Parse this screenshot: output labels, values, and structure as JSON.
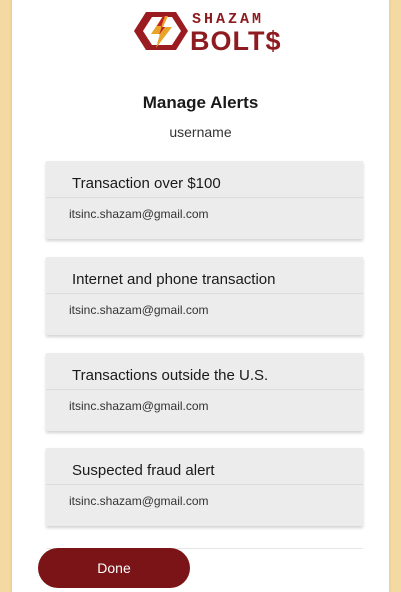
{
  "brand": {
    "top": "SHAZAM",
    "bottom": "BOLT$",
    "color": "#8e1b1f"
  },
  "header": {
    "title": "Manage Alerts",
    "username": "username"
  },
  "alerts": [
    {
      "title": "Transaction over $100",
      "email": "itsinc.shazam@gmail.com"
    },
    {
      "title": "Internet and phone transaction",
      "email": "itsinc.shazam@gmail.com"
    },
    {
      "title": "Transactions outside the U.S.",
      "email": "itsinc.shazam@gmail.com"
    },
    {
      "title": "Suspected fraud alert",
      "email": "itsinc.shazam@gmail.com"
    }
  ],
  "footer": {
    "done_label": "Done"
  },
  "colors": {
    "accent": "#7a1417",
    "background": "#f5d9a3",
    "card": "#ececec"
  }
}
